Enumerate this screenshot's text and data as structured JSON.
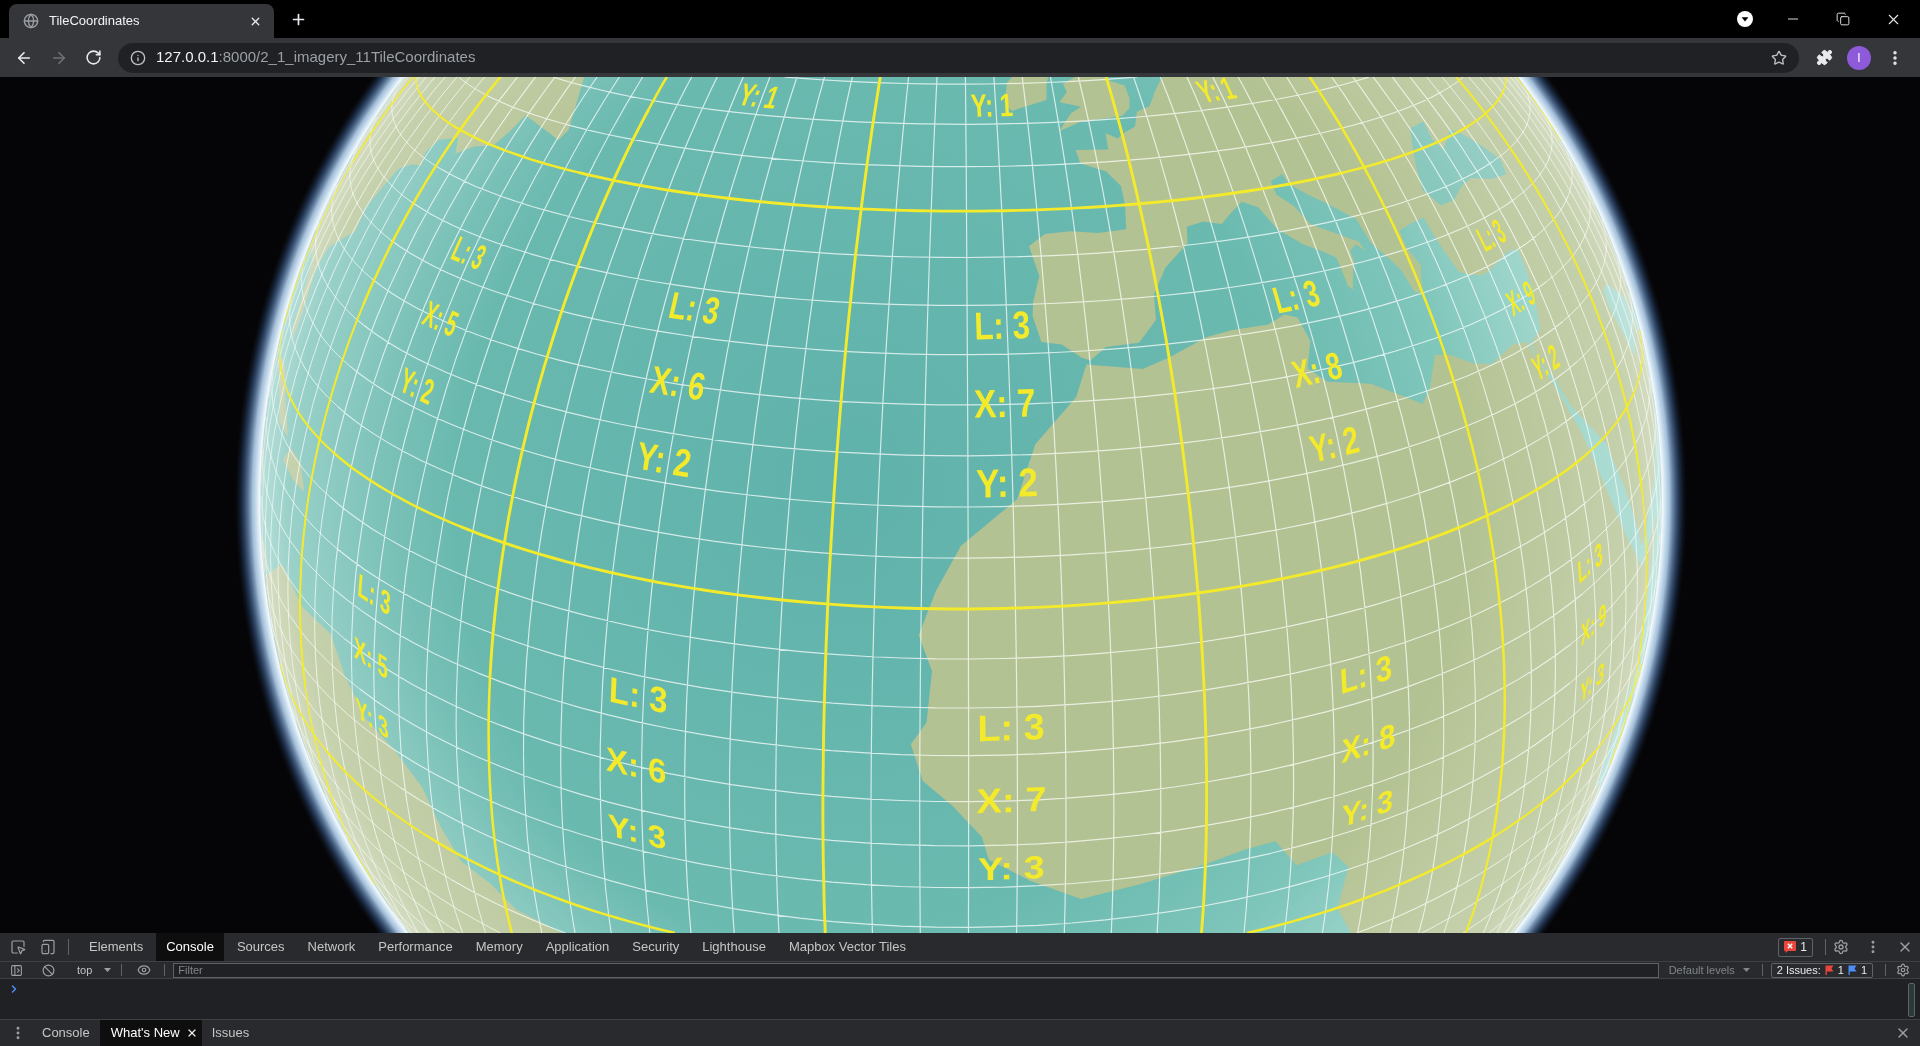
{
  "browser": {
    "tabs": [
      {
        "title": "TileCoordinates",
        "selected": true
      }
    ],
    "toolbar": {
      "back_disabled": false,
      "forward_disabled": true,
      "url_host": "127.0.0.1",
      "url_path": ":8000/2_1_imagery_11TileCoordinates",
      "profile_initial": "I"
    }
  },
  "globe": {
    "tiles": [
      {
        "label_y": "Y: 1"
      },
      {
        "label_y": "Y: 1"
      },
      {
        "label_y": "Y: 1"
      },
      {
        "label_l": "L: 3",
        "label_x": "X: 5",
        "label_y": "Y: 2"
      },
      {
        "label_l": "L: 3",
        "label_x": "X: 6",
        "label_y": "Y: 2"
      },
      {
        "label_l": "L: 3",
        "label_x": "X: 7",
        "label_y": "Y: 2"
      },
      {
        "label_l": "L: 3",
        "label_x": "X: 8",
        "label_y": "Y: 2"
      },
      {
        "label_l": "L: 3",
        "label_x": "X: 9",
        "label_y": "Y: 2"
      },
      {
        "label_l": "L: 3",
        "label_x": "X: 5",
        "label_y": "Y: 3"
      },
      {
        "label_l": "L: 3",
        "label_x": "X: 6",
        "label_y": "Y: 3"
      },
      {
        "label_l": "L: 3",
        "label_x": "X: 7",
        "label_y": "Y: 3"
      },
      {
        "label_l": "L: 3",
        "label_x": "X: 8",
        "label_y": "Y: 3"
      },
      {
        "label_l": "L: 3",
        "label_x": "X: 9",
        "label_y": "Y: 3"
      }
    ]
  },
  "devtools": {
    "tabs": [
      {
        "label": "Elements",
        "selected": false
      },
      {
        "label": "Console",
        "selected": true
      },
      {
        "label": "Sources",
        "selected": false
      },
      {
        "label": "Network",
        "selected": false
      },
      {
        "label": "Performance",
        "selected": false
      },
      {
        "label": "Memory",
        "selected": false
      },
      {
        "label": "Application",
        "selected": false
      },
      {
        "label": "Security",
        "selected": false
      },
      {
        "label": "Lighthouse",
        "selected": false
      },
      {
        "label": "Mapbox Vector Tiles",
        "selected": false
      }
    ],
    "error_count": "1",
    "console_toolbar": {
      "context": "top",
      "filter": {
        "placeholder": "Filter"
      },
      "levels": "Default levels",
      "issues_label": "2 Issues:",
      "issues_errors": "1",
      "issues_info": "1"
    },
    "drawer_tabs": [
      {
        "label": "Console",
        "selected": false,
        "closable": false
      },
      {
        "label": "What's New",
        "selected": true,
        "closable": true
      },
      {
        "label": "Issues",
        "selected": false,
        "closable": false
      }
    ]
  }
}
